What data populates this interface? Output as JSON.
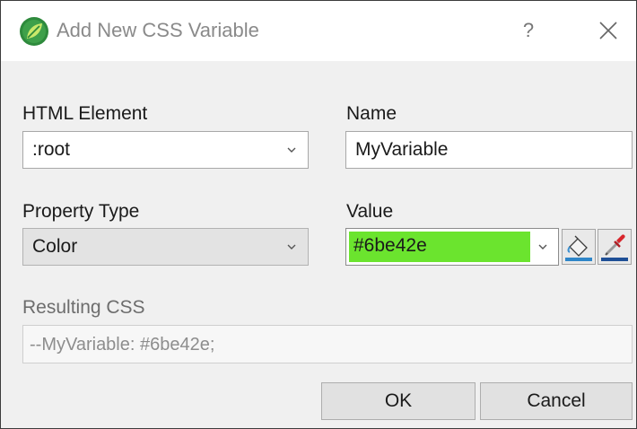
{
  "window": {
    "title": "Add New CSS Variable",
    "help_label": "?",
    "app_icon": "leaf-logo-icon",
    "close_icon": "close-icon"
  },
  "form": {
    "html_element": {
      "label": "HTML Element",
      "value": ":root"
    },
    "name": {
      "label": "Name",
      "value": "MyVariable"
    },
    "property_type": {
      "label": "Property Type",
      "value": "Color"
    },
    "value": {
      "label": "Value",
      "value": "#6be42e",
      "swatch_color": "#6be42e"
    },
    "resulting_css": {
      "label": "Resulting CSS",
      "value": "--MyVariable: #6be42e;"
    }
  },
  "tools": {
    "fill_icon": "paint-bucket-icon",
    "picker_icon": "color-picker-icon"
  },
  "buttons": {
    "ok": "OK",
    "cancel": "Cancel"
  },
  "colors": {
    "accent_green": "#6be42e",
    "app_icon_green": "#2e8a3c"
  }
}
